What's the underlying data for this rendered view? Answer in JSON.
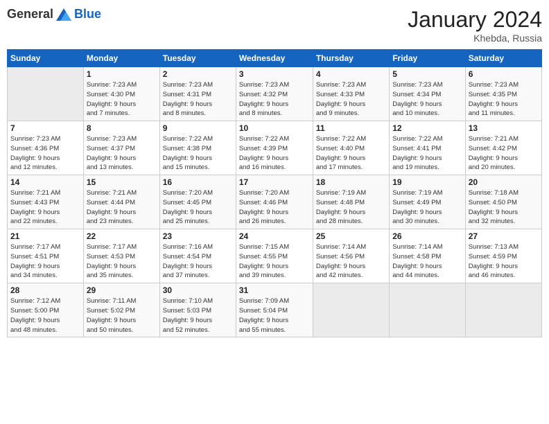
{
  "header": {
    "logo_general": "General",
    "logo_blue": "Blue",
    "month": "January 2024",
    "location": "Khebda, Russia"
  },
  "days_of_week": [
    "Sunday",
    "Monday",
    "Tuesday",
    "Wednesday",
    "Thursday",
    "Friday",
    "Saturday"
  ],
  "weeks": [
    [
      {
        "date": "",
        "info": ""
      },
      {
        "date": "1",
        "info": "Sunrise: 7:23 AM\nSunset: 4:30 PM\nDaylight: 9 hours\nand 7 minutes."
      },
      {
        "date": "2",
        "info": "Sunrise: 7:23 AM\nSunset: 4:31 PM\nDaylight: 9 hours\nand 8 minutes."
      },
      {
        "date": "3",
        "info": "Sunrise: 7:23 AM\nSunset: 4:32 PM\nDaylight: 9 hours\nand 8 minutes."
      },
      {
        "date": "4",
        "info": "Sunrise: 7:23 AM\nSunset: 4:33 PM\nDaylight: 9 hours\nand 9 minutes."
      },
      {
        "date": "5",
        "info": "Sunrise: 7:23 AM\nSunset: 4:34 PM\nDaylight: 9 hours\nand 10 minutes."
      },
      {
        "date": "6",
        "info": "Sunrise: 7:23 AM\nSunset: 4:35 PM\nDaylight: 9 hours\nand 11 minutes."
      }
    ],
    [
      {
        "date": "7",
        "info": "Sunrise: 7:23 AM\nSunset: 4:36 PM\nDaylight: 9 hours\nand 12 minutes."
      },
      {
        "date": "8",
        "info": "Sunrise: 7:23 AM\nSunset: 4:37 PM\nDaylight: 9 hours\nand 13 minutes."
      },
      {
        "date": "9",
        "info": "Sunrise: 7:22 AM\nSunset: 4:38 PM\nDaylight: 9 hours\nand 15 minutes."
      },
      {
        "date": "10",
        "info": "Sunrise: 7:22 AM\nSunset: 4:39 PM\nDaylight: 9 hours\nand 16 minutes."
      },
      {
        "date": "11",
        "info": "Sunrise: 7:22 AM\nSunset: 4:40 PM\nDaylight: 9 hours\nand 17 minutes."
      },
      {
        "date": "12",
        "info": "Sunrise: 7:22 AM\nSunset: 4:41 PM\nDaylight: 9 hours\nand 19 minutes."
      },
      {
        "date": "13",
        "info": "Sunrise: 7:21 AM\nSunset: 4:42 PM\nDaylight: 9 hours\nand 20 minutes."
      }
    ],
    [
      {
        "date": "14",
        "info": "Sunrise: 7:21 AM\nSunset: 4:43 PM\nDaylight: 9 hours\nand 22 minutes."
      },
      {
        "date": "15",
        "info": "Sunrise: 7:21 AM\nSunset: 4:44 PM\nDaylight: 9 hours\nand 23 minutes."
      },
      {
        "date": "16",
        "info": "Sunrise: 7:20 AM\nSunset: 4:45 PM\nDaylight: 9 hours\nand 25 minutes."
      },
      {
        "date": "17",
        "info": "Sunrise: 7:20 AM\nSunset: 4:46 PM\nDaylight: 9 hours\nand 26 minutes."
      },
      {
        "date": "18",
        "info": "Sunrise: 7:19 AM\nSunset: 4:48 PM\nDaylight: 9 hours\nand 28 minutes."
      },
      {
        "date": "19",
        "info": "Sunrise: 7:19 AM\nSunset: 4:49 PM\nDaylight: 9 hours\nand 30 minutes."
      },
      {
        "date": "20",
        "info": "Sunrise: 7:18 AM\nSunset: 4:50 PM\nDaylight: 9 hours\nand 32 minutes."
      }
    ],
    [
      {
        "date": "21",
        "info": "Sunrise: 7:17 AM\nSunset: 4:51 PM\nDaylight: 9 hours\nand 34 minutes."
      },
      {
        "date": "22",
        "info": "Sunrise: 7:17 AM\nSunset: 4:53 PM\nDaylight: 9 hours\nand 35 minutes."
      },
      {
        "date": "23",
        "info": "Sunrise: 7:16 AM\nSunset: 4:54 PM\nDaylight: 9 hours\nand 37 minutes."
      },
      {
        "date": "24",
        "info": "Sunrise: 7:15 AM\nSunset: 4:55 PM\nDaylight: 9 hours\nand 39 minutes."
      },
      {
        "date": "25",
        "info": "Sunrise: 7:14 AM\nSunset: 4:56 PM\nDaylight: 9 hours\nand 42 minutes."
      },
      {
        "date": "26",
        "info": "Sunrise: 7:14 AM\nSunset: 4:58 PM\nDaylight: 9 hours\nand 44 minutes."
      },
      {
        "date": "27",
        "info": "Sunrise: 7:13 AM\nSunset: 4:59 PM\nDaylight: 9 hours\nand 46 minutes."
      }
    ],
    [
      {
        "date": "28",
        "info": "Sunrise: 7:12 AM\nSunset: 5:00 PM\nDaylight: 9 hours\nand 48 minutes."
      },
      {
        "date": "29",
        "info": "Sunrise: 7:11 AM\nSunset: 5:02 PM\nDaylight: 9 hours\nand 50 minutes."
      },
      {
        "date": "30",
        "info": "Sunrise: 7:10 AM\nSunset: 5:03 PM\nDaylight: 9 hours\nand 52 minutes."
      },
      {
        "date": "31",
        "info": "Sunrise: 7:09 AM\nSunset: 5:04 PM\nDaylight: 9 hours\nand 55 minutes."
      },
      {
        "date": "",
        "info": ""
      },
      {
        "date": "",
        "info": ""
      },
      {
        "date": "",
        "info": ""
      }
    ]
  ]
}
